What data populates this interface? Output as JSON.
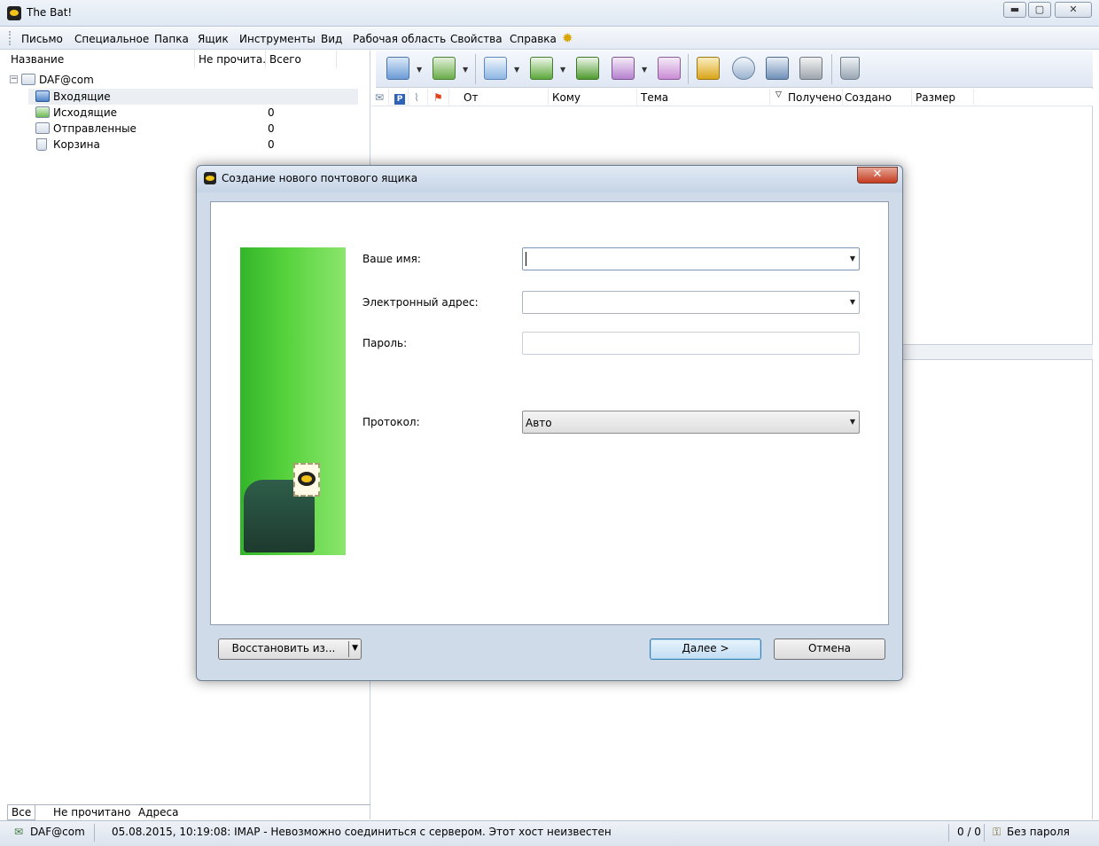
{
  "window": {
    "title": "The Bat!",
    "minimize": "▬",
    "maximize": "▢",
    "close": "✕"
  },
  "menu": [
    "Письмо",
    "Специальное",
    "Папка",
    "Ящик",
    "Инструменты",
    "Вид",
    "Рабочая область",
    "Свойства",
    "Справка"
  ],
  "folders": {
    "headers": {
      "name": "Название",
      "unread": "Не прочита...",
      "total": "Всего"
    },
    "account": "DAF@com",
    "items": [
      {
        "label": "Входящие",
        "total": ""
      },
      {
        "label": "Исходящие",
        "total": "0"
      },
      {
        "label": "Отправленные",
        "total": "0"
      },
      {
        "label": "Корзина",
        "total": "0"
      }
    ],
    "tabs": [
      "Все",
      "Не прочитано",
      "Адреса"
    ]
  },
  "messages": {
    "columns": {
      "from": "От",
      "to": "Кому",
      "subject": "Тема",
      "received": "Получено",
      "created": "Создано",
      "size": "Размер"
    }
  },
  "statusbar": {
    "account": "DAF@com",
    "message": "05.08.2015, 10:19:08: IMAP  - Невозможно соединиться с сервером. Этот хост неизвестен",
    "counter": "0 / 0",
    "password": "Без пароля"
  },
  "dialog": {
    "title": "Создание нового почтового ящика",
    "close": "✕",
    "name_label": "Ваше имя:",
    "name_value": "",
    "email_label": "Электронный адрес:",
    "email_value": "",
    "password_label": "Пароль:",
    "password_value": "",
    "protocol_label": "Протокол:",
    "protocol_value": "Авто",
    "restore_button": "Восстановить из...",
    "next_button": "Далее  >",
    "cancel_button": "Отмена"
  },
  "colors": {
    "accent_green": "#4cc536",
    "close_red": "#c43b1f",
    "chrome": "#dfe8f3"
  }
}
